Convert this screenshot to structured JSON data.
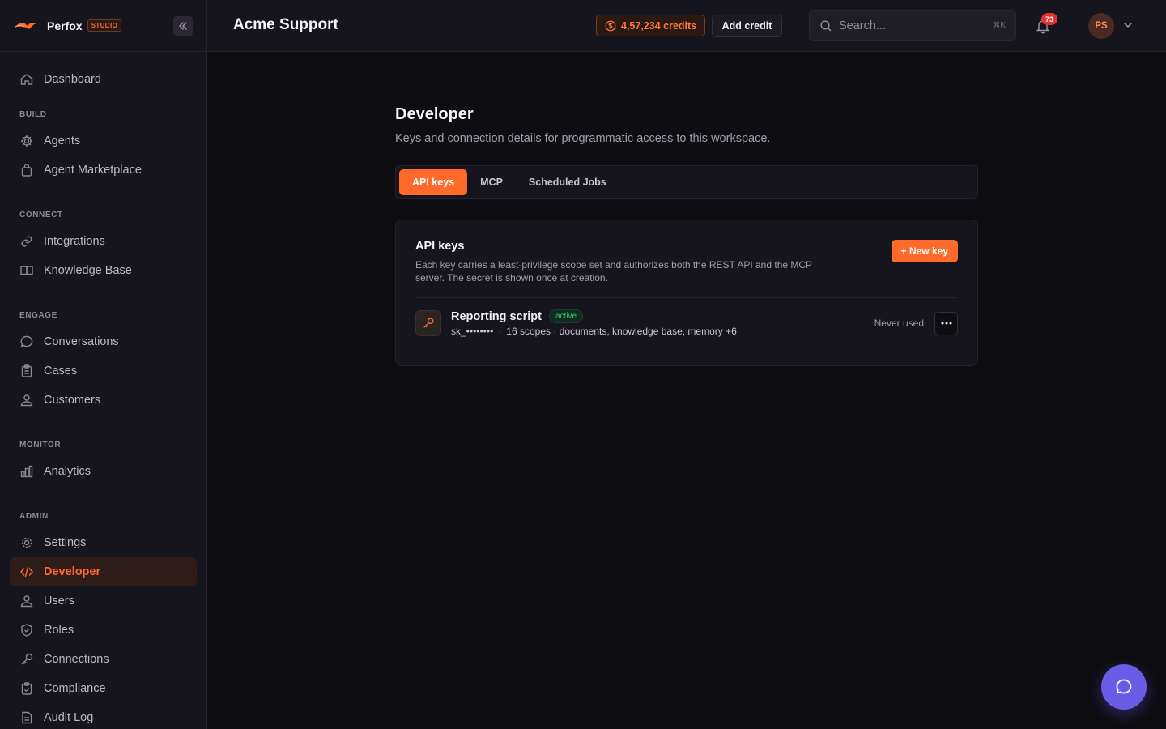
{
  "brand": {
    "name": "Perfox",
    "badge": "STUDIO",
    "accent": "#ff6a2b"
  },
  "sidebar": {
    "top_items": [
      {
        "label": "Dashboard",
        "icon": "home-icon"
      }
    ],
    "sections": [
      {
        "title": "BUILD",
        "items": [
          {
            "label": "Agents",
            "icon": "gear-icon"
          },
          {
            "label": "Agent Marketplace",
            "icon": "shopping-bag-icon"
          }
        ]
      },
      {
        "title": "CONNECT",
        "items": [
          {
            "label": "Integrations",
            "icon": "link-icon"
          },
          {
            "label": "Knowledge Base",
            "icon": "book-icon"
          }
        ]
      },
      {
        "title": "ENGAGE",
        "items": [
          {
            "label": "Conversations",
            "icon": "chat-bubble-icon"
          },
          {
            "label": "Cases",
            "icon": "clipboard-icon"
          },
          {
            "label": "Customers",
            "icon": "users-icon"
          }
        ]
      },
      {
        "title": "MONITOR",
        "items": [
          {
            "label": "Analytics",
            "icon": "bar-chart-icon"
          }
        ]
      },
      {
        "title": "ADMIN",
        "items": [
          {
            "label": "Settings",
            "icon": "gear-icon"
          },
          {
            "label": "Developer",
            "icon": "code-icon",
            "active": true
          },
          {
            "label": "Users",
            "icon": "users-icon"
          },
          {
            "label": "Roles",
            "icon": "shield-icon"
          },
          {
            "label": "Connections",
            "icon": "key-icon"
          },
          {
            "label": "Compliance",
            "icon": "clipboard-check-icon"
          },
          {
            "label": "Audit Log",
            "icon": "document-icon"
          }
        ]
      }
    ]
  },
  "header": {
    "workspace_title": "Acme Support",
    "credits": "4,57,234 credits",
    "add_credit": "Add credit",
    "search_placeholder": "Search...",
    "search_shortcut": "⌘K",
    "notification_count": "73",
    "avatar_initials": "PS"
  },
  "page": {
    "title": "Developer",
    "subtitle": "Keys and connection details for programmatic access to this workspace.",
    "tabs": [
      {
        "label": "API keys",
        "active": true
      },
      {
        "label": "MCP"
      },
      {
        "label": "Scheduled Jobs"
      }
    ]
  },
  "api_keys": {
    "title": "API keys",
    "description": "Each key carries a least-privilege scope set and authorizes both the REST API and the MCP server. The secret is shown once at creation.",
    "new_key_label": "+ New key",
    "keys": [
      {
        "name": "Reporting script",
        "status": "active",
        "prefix": "sk_••••••••",
        "scopes": "16 scopes · documents, knowledge base, memory +6",
        "last_used": "Never used"
      }
    ]
  },
  "colors": {
    "background": "#0e0d12",
    "panel": "#16141c",
    "accent": "#ff6a2b",
    "chat": "#6b5ce7",
    "status_active": "#34c47c"
  }
}
